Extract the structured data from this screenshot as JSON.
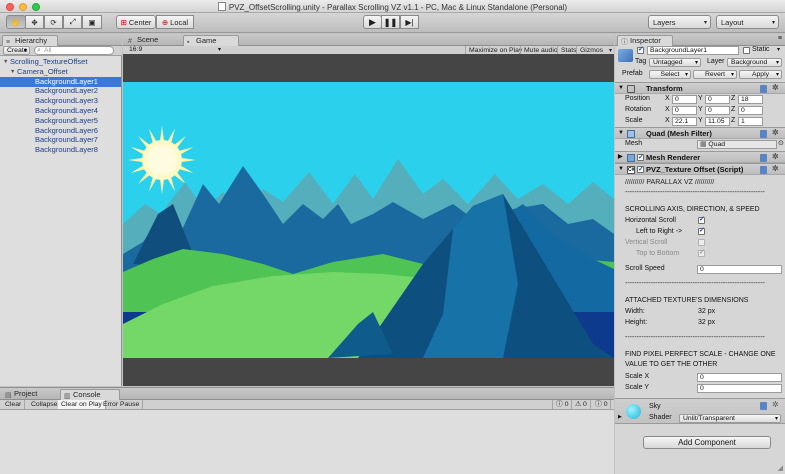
{
  "window": {
    "title": "PVZ_OffsetScrolling.unity - Parallax Scrolling VZ v1.1 - PC, Mac & Linux Standalone (Personal)"
  },
  "toolbar": {
    "pivot": "Center",
    "space": "Local",
    "layers": "Layers",
    "layout": "Layout",
    "tools": [
      "hand-tool",
      "move-tool",
      "rotate-tool",
      "scale-tool",
      "rect-tool"
    ]
  },
  "hierarchy": {
    "tab": "Hierarchy",
    "create": "Create",
    "search_placeholder": "All",
    "items": [
      {
        "label": "Scrolling_TextureOffset",
        "depth": 0,
        "expanded": true,
        "selected": false
      },
      {
        "label": "Camera_Offset",
        "depth": 1,
        "expanded": true,
        "selected": false
      },
      {
        "label": "BackgroundLayer1",
        "depth": 2,
        "selected": true
      },
      {
        "label": "BackgroundLayer2",
        "depth": 2,
        "selected": false
      },
      {
        "label": "BackgroundLayer3",
        "depth": 2,
        "selected": false
      },
      {
        "label": "BackgroundLayer4",
        "depth": 2,
        "selected": false
      },
      {
        "label": "BackgroundLayer5",
        "depth": 2,
        "selected": false
      },
      {
        "label": "BackgroundLayer6",
        "depth": 2,
        "selected": false
      },
      {
        "label": "BackgroundLayer7",
        "depth": 2,
        "selected": false
      },
      {
        "label": "BackgroundLayer8",
        "depth": 2,
        "selected": false
      }
    ]
  },
  "view": {
    "scene_tab": "Scene",
    "game_tab": "Game",
    "aspect": "16:9",
    "buttons": [
      "Maximize on Play",
      "Mute audio",
      "Stats",
      "Gizmos"
    ]
  },
  "console": {
    "project_tab": "Project",
    "console_tab": "Console",
    "buttons": [
      "Clear",
      "Collapse",
      "Clear on Play",
      "Error Pause"
    ],
    "counts": {
      "info": "0",
      "warn": "0",
      "error": "0"
    }
  },
  "inspector": {
    "tab": "Inspector",
    "object_name": "BackgroundLayer1",
    "static_label": "Static",
    "tag_label": "Tag",
    "tag_value": "Untagged",
    "layer_label": "Layer",
    "layer_value": "Background",
    "prefab_label": "Prefab",
    "prefab_buttons": [
      "Select",
      "Revert",
      "Apply"
    ],
    "transform": {
      "title": "Transform",
      "rows": [
        {
          "label": "Position",
          "x": "0",
          "y": "0",
          "z": "18"
        },
        {
          "label": "Rotation",
          "x": "0",
          "y": "0",
          "z": "0"
        },
        {
          "label": "Scale",
          "x": "22.1",
          "y": "11.05",
          "z": "1"
        }
      ]
    },
    "mesh_filter": {
      "title": "Quad (Mesh Filter)",
      "mesh_label": "Mesh",
      "mesh_value": "Quad"
    },
    "mesh_renderer": {
      "title": "Mesh Renderer"
    },
    "script": {
      "title": "PVZ_Texture Offset (Script)",
      "banner": "//////////    PARALLAX VZ    //////////",
      "dashes": "------------------------------------------------------------",
      "section1": "SCROLLING AXIS, DIRECTION, & SPEED",
      "horizontal_scroll": "Horizontal Scroll",
      "left_to_right": "Left to Right ->",
      "vertical_scroll": "Vertical Scroll",
      "top_to_bottom": "Top to Bottom",
      "scroll_speed_label": "Scroll Speed",
      "scroll_speed_value": "0",
      "section2": "ATTACHED TEXTURE'S DIMENSIONS",
      "width_label": "Width:",
      "width_value": "32 px",
      "height_label": "Height:",
      "height_value": "32 px",
      "section3_line1": "FIND PIXEL PERFECT SCALE - CHANGE ONE",
      "section3_line2": "VALUE TO GET THE OTHER",
      "scale_x_label": "Scale X",
      "scale_x_value": "0",
      "scale_y_label": "Scale Y",
      "scale_y_value": "0"
    },
    "material": {
      "name": "Sky",
      "shader_label": "Shader",
      "shader_value": "Unlit/Transparent"
    },
    "add_component": "Add Component"
  }
}
